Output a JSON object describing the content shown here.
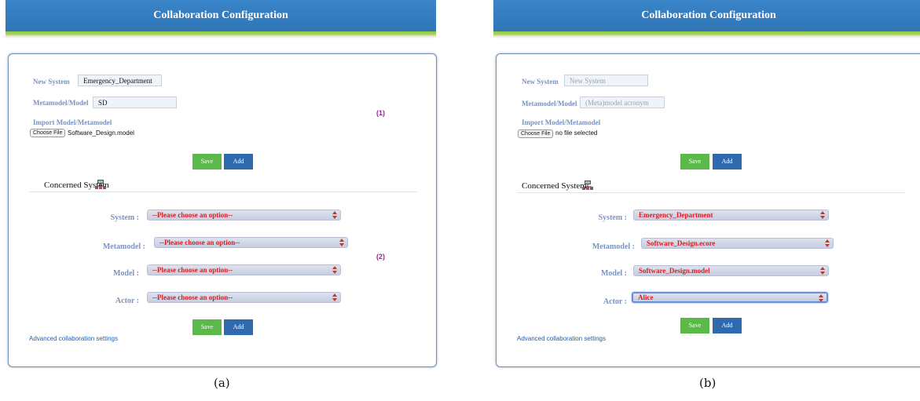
{
  "panels": {
    "a": {
      "title": "Collaboration Configuration",
      "new_system_label": "New System",
      "new_system_value": "Emergency_Department",
      "metamodel_label": "Metamodel/Model",
      "metamodel_value": "SD",
      "import_label": "Import Model/Metamodel",
      "choose_file": "Choose File",
      "file_name": "Software_Design.model",
      "marker_1": "(1)",
      "save": "Save",
      "add": "Add",
      "concerned_system": "Concerned System",
      "system_label": "System :",
      "system_value": "--Please choose an option--",
      "metamodel_sel_label": "Metamodel :",
      "metamodel_sel_value": "--Please choose an option--",
      "marker_2": "(2)",
      "model_label": "Model :",
      "model_value": "--Please choose an option--",
      "actor_label": "Actor :",
      "actor_value": "--Please choose an option--",
      "save2": "Save",
      "add2": "Add",
      "advanced": "Advanced collaboration settings",
      "caption": "(a)"
    },
    "b": {
      "title": "Collaboration Configuration",
      "new_system_label": "New System",
      "new_system_placeholder": "New System",
      "metamodel_label": "Metamodel/Model",
      "metamodel_placeholder": "(Meta)model acronym",
      "import_label": "Import Model/Metamodel",
      "choose_file": "Choose File",
      "file_name": "no file selected",
      "save": "Save",
      "add": "Add",
      "concerned_system": "Concerned System",
      "system_label": "System :",
      "system_value": "Emergency_Department",
      "metamodel_sel_label": "Metamodel :",
      "metamodel_sel_value": "Software_Design.ecore",
      "model_label": "Model :",
      "model_value": "Software_Design.model",
      "actor_label": "Actor :",
      "actor_value": "Alice",
      "save2": "Save",
      "add2": "Add",
      "advanced": "Advanced collaboration settings",
      "caption": "(b)"
    }
  },
  "colors": {
    "header_blue": "#3a84c9",
    "header_stripe_green": "#8fc63f",
    "label_blue": "#7b93bd",
    "select_text_red": "#e01b1b",
    "save_green": "#5bb94b",
    "add_blue": "#2f6aae",
    "marker_purple": "#8e2a8e",
    "link_blue": "#1f5fae"
  },
  "icons": {
    "system": "network-system-icon",
    "select_arrows": "up-down-arrows-icon"
  }
}
